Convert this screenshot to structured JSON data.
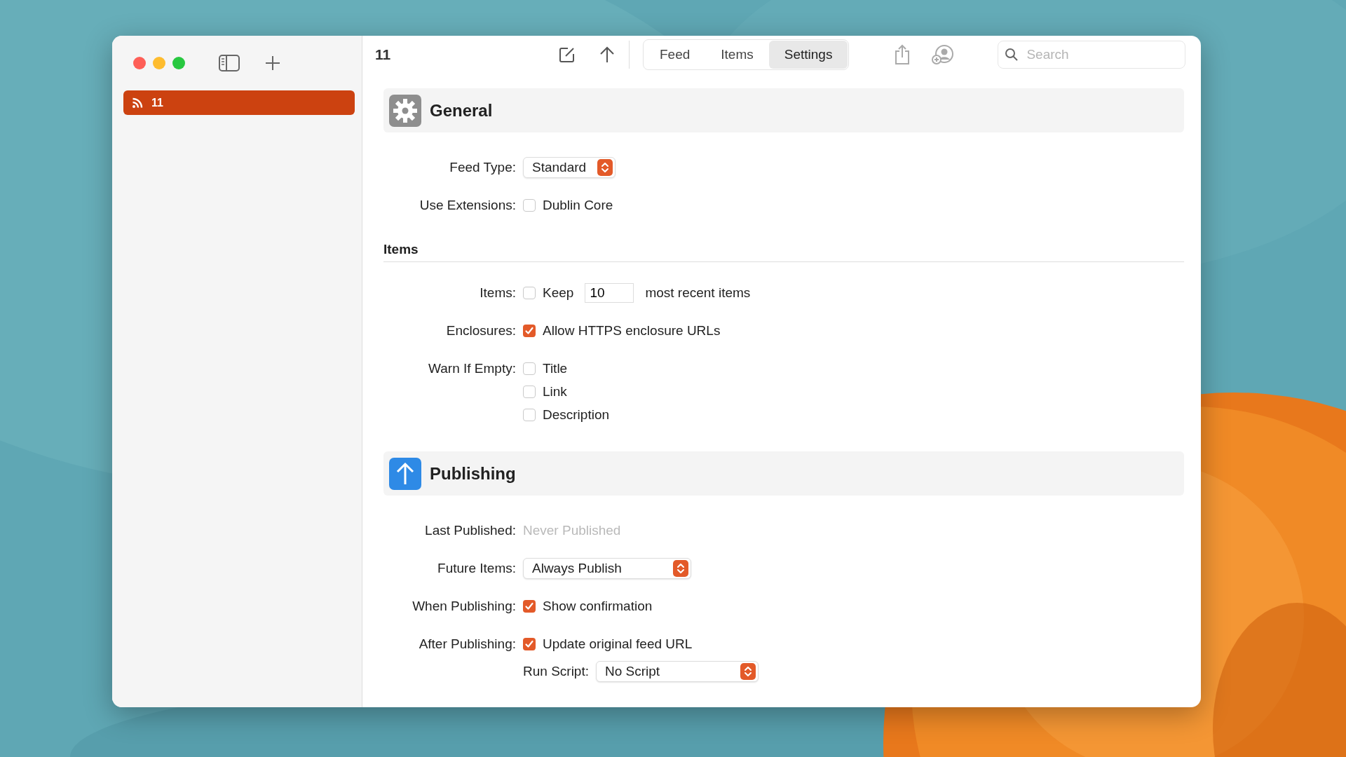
{
  "sidebar": {
    "items": [
      {
        "label": "11",
        "selected": true
      }
    ]
  },
  "toolbar": {
    "title": "11",
    "tabs": [
      {
        "label": "Feed",
        "selected": false
      },
      {
        "label": "Items",
        "selected": false
      },
      {
        "label": "Settings",
        "selected": true
      }
    ],
    "search": {
      "placeholder": "Search"
    }
  },
  "general": {
    "title": "General",
    "rows": [
      {
        "kind": "popup",
        "label": "Feed Type:",
        "value": "Standard"
      },
      {
        "kind": "checks",
        "label": "Use Extensions:",
        "options": [
          {
            "label": "Dublin Core",
            "checked": false
          }
        ]
      }
    ]
  },
  "items": {
    "title": "Items",
    "rows": [
      {
        "kind": "keep",
        "label": "Items:",
        "checked": false,
        "text": "Keep",
        "value": "10",
        "suffix": "most recent items"
      },
      {
        "kind": "checks",
        "label": "Enclosures:",
        "options": [
          {
            "label": "Allow HTTPS enclosure URLs",
            "checked": true
          }
        ]
      },
      {
        "kind": "checks",
        "label": "Warn If Empty:",
        "options": [
          {
            "label": "Title",
            "checked": false
          },
          {
            "label": "Link",
            "checked": false
          },
          {
            "label": "Description",
            "checked": false
          }
        ]
      }
    ]
  },
  "publishing": {
    "title": "Publishing",
    "rows": [
      {
        "kind": "text",
        "label": "Last Published:",
        "value": "Never Published"
      },
      {
        "kind": "popup",
        "label": "Future Items:",
        "value": "Always Publish"
      },
      {
        "kind": "checks",
        "label": "When Publishing:",
        "options": [
          {
            "label": "Show confirmation",
            "checked": true
          }
        ]
      },
      {
        "kind": "checks",
        "label": "After Publishing:",
        "options": [
          {
            "label": "Update original feed URL",
            "checked": true
          }
        ]
      },
      {
        "kind": "subpopup",
        "label": "Run Script:",
        "value": "No Script"
      }
    ]
  }
}
